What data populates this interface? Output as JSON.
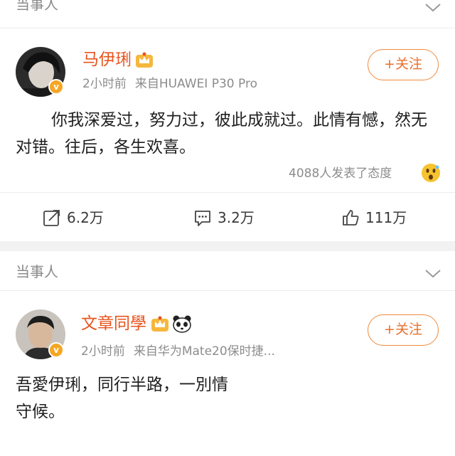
{
  "posts": [
    {
      "section_label": "当事人",
      "username": "马伊琍",
      "time": "2小时前",
      "source": "来自HUAWEI P30 Pro",
      "follow_label": "+关注",
      "content": "你我深爱过，努力过，彼此成就过。此情有憾，然无对错。往后，各生欢喜。",
      "reaction_text": "4088人发表了态度",
      "actions": {
        "repost": "6.2万",
        "comment": "3.2万",
        "like": "111万"
      }
    },
    {
      "section_label": "当事人",
      "username": "文章同學",
      "time": "2小时前",
      "source": "来自华为Mate20保时捷...",
      "follow_label": "+关注",
      "content": "吾愛伊琍，同行半路，一別情守候。"
    }
  ],
  "icons": {
    "collapse": "chevron-down-icon",
    "verified": "verified-badge-icon",
    "member": "crown-icon",
    "panda": "panda-icon",
    "reaction": "wow-emoji-icon",
    "repost": "repost-icon",
    "comment": "comment-icon",
    "like": "like-icon"
  },
  "colors": {
    "username": "#e8541e",
    "follow_border": "#f08a3c",
    "verified_badge": "#f5a623",
    "meta_text": "#8c8c8c",
    "section_gap": "#f2f2f2"
  }
}
